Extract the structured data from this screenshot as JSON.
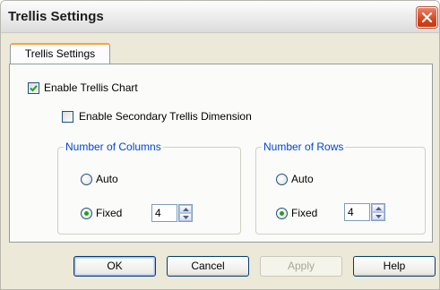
{
  "window": {
    "title": "Trellis Settings"
  },
  "tabs": [
    {
      "label": "Trellis Settings"
    }
  ],
  "options": {
    "enable_trellis": {
      "label": "Enable Trellis Chart",
      "checked": true
    },
    "enable_secondary": {
      "label": "Enable Secondary Trellis Dimension",
      "checked": false
    }
  },
  "columns": {
    "title": "Number of Columns",
    "auto_label": "Auto",
    "fixed_label": "Fixed",
    "selected": "fixed",
    "value": "4"
  },
  "rows": {
    "title": "Number of Rows",
    "auto_label": "Auto",
    "fixed_label": "Fixed",
    "selected": "fixed",
    "value": "4"
  },
  "buttons": {
    "ok": "OK",
    "cancel": "Cancel",
    "apply": "Apply",
    "help": "Help"
  },
  "colors": {
    "accent_tab": "#f5a43a",
    "group_title": "#0046d5",
    "radio_dot": "#21a121"
  }
}
